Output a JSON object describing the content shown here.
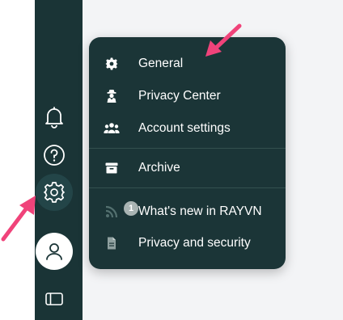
{
  "colors": {
    "sidebar": "#1a3436",
    "menu": "#1b3537",
    "accent_arrow": "#f0437a",
    "badge": "#a9b4b3"
  },
  "sidebar": {
    "icons": [
      "bell-icon",
      "help-icon",
      "gear-icon",
      "user-icon",
      "panel-toggle-icon"
    ]
  },
  "settings_menu": {
    "items": [
      {
        "label": "General",
        "icon": "gear-icon"
      },
      {
        "label": "Privacy Center",
        "icon": "privacy-agent-icon"
      },
      {
        "label": "Account settings",
        "icon": "users-icon"
      },
      {
        "label": "Archive",
        "icon": "archive-box-icon"
      },
      {
        "label": "What's new in RAYVN",
        "icon": "rss-icon",
        "badge": "1"
      },
      {
        "label": "Privacy and security",
        "icon": "document-icon"
      }
    ]
  }
}
